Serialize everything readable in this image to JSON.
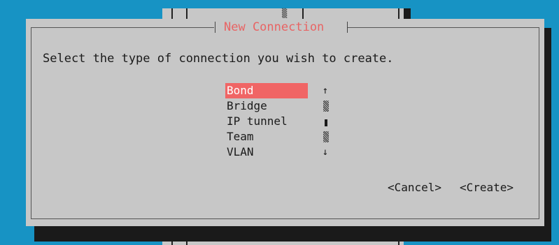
{
  "dialog": {
    "title": "New Connection",
    "prompt": "Select the type of connection you wish to create."
  },
  "connection_types": {
    "items": [
      {
        "label": "Bond",
        "selected": true
      },
      {
        "label": "Bridge",
        "selected": false
      },
      {
        "label": "IP tunnel",
        "selected": false
      },
      {
        "label": "Team",
        "selected": false
      },
      {
        "label": "VLAN",
        "selected": false
      }
    ]
  },
  "scrollbar": {
    "up_arrow": "↑",
    "down_arrow": "↓"
  },
  "buttons": {
    "cancel": "<Cancel>",
    "create": "<Create>"
  },
  "colors": {
    "background": "#1793c4",
    "dialog": "#c7c7c7",
    "shadow": "#1a1a1a",
    "accent": "#f06565",
    "title": "#e86464"
  }
}
